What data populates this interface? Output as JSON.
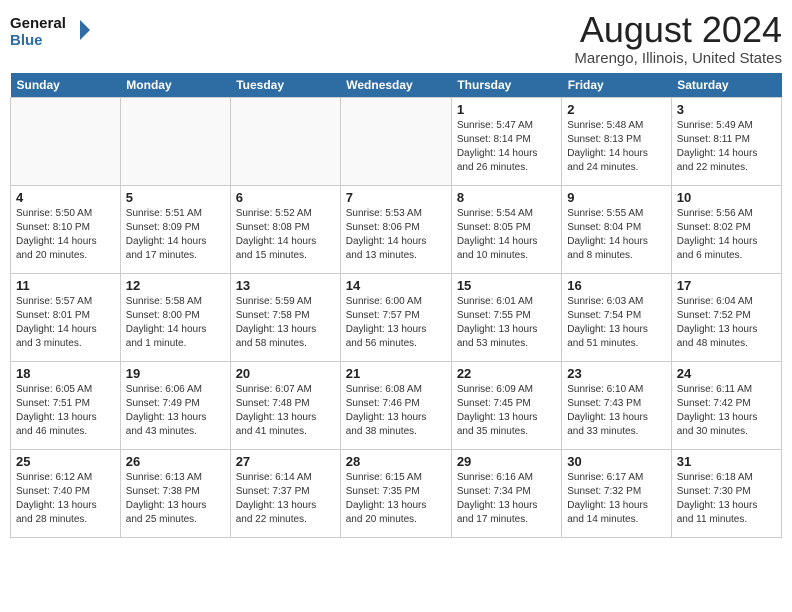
{
  "logo": {
    "line1": "General",
    "line2": "Blue"
  },
  "title": "August 2024",
  "location": "Marengo, Illinois, United States",
  "weekdays": [
    "Sunday",
    "Monday",
    "Tuesday",
    "Wednesday",
    "Thursday",
    "Friday",
    "Saturday"
  ],
  "weeks": [
    [
      {
        "day": "",
        "info": ""
      },
      {
        "day": "",
        "info": ""
      },
      {
        "day": "",
        "info": ""
      },
      {
        "day": "",
        "info": ""
      },
      {
        "day": "1",
        "info": "Sunrise: 5:47 AM\nSunset: 8:14 PM\nDaylight: 14 hours\nand 26 minutes."
      },
      {
        "day": "2",
        "info": "Sunrise: 5:48 AM\nSunset: 8:13 PM\nDaylight: 14 hours\nand 24 minutes."
      },
      {
        "day": "3",
        "info": "Sunrise: 5:49 AM\nSunset: 8:11 PM\nDaylight: 14 hours\nand 22 minutes."
      }
    ],
    [
      {
        "day": "4",
        "info": "Sunrise: 5:50 AM\nSunset: 8:10 PM\nDaylight: 14 hours\nand 20 minutes."
      },
      {
        "day": "5",
        "info": "Sunrise: 5:51 AM\nSunset: 8:09 PM\nDaylight: 14 hours\nand 17 minutes."
      },
      {
        "day": "6",
        "info": "Sunrise: 5:52 AM\nSunset: 8:08 PM\nDaylight: 14 hours\nand 15 minutes."
      },
      {
        "day": "7",
        "info": "Sunrise: 5:53 AM\nSunset: 8:06 PM\nDaylight: 14 hours\nand 13 minutes."
      },
      {
        "day": "8",
        "info": "Sunrise: 5:54 AM\nSunset: 8:05 PM\nDaylight: 14 hours\nand 10 minutes."
      },
      {
        "day": "9",
        "info": "Sunrise: 5:55 AM\nSunset: 8:04 PM\nDaylight: 14 hours\nand 8 minutes."
      },
      {
        "day": "10",
        "info": "Sunrise: 5:56 AM\nSunset: 8:02 PM\nDaylight: 14 hours\nand 6 minutes."
      }
    ],
    [
      {
        "day": "11",
        "info": "Sunrise: 5:57 AM\nSunset: 8:01 PM\nDaylight: 14 hours\nand 3 minutes."
      },
      {
        "day": "12",
        "info": "Sunrise: 5:58 AM\nSunset: 8:00 PM\nDaylight: 14 hours\nand 1 minute."
      },
      {
        "day": "13",
        "info": "Sunrise: 5:59 AM\nSunset: 7:58 PM\nDaylight: 13 hours\nand 58 minutes."
      },
      {
        "day": "14",
        "info": "Sunrise: 6:00 AM\nSunset: 7:57 PM\nDaylight: 13 hours\nand 56 minutes."
      },
      {
        "day": "15",
        "info": "Sunrise: 6:01 AM\nSunset: 7:55 PM\nDaylight: 13 hours\nand 53 minutes."
      },
      {
        "day": "16",
        "info": "Sunrise: 6:03 AM\nSunset: 7:54 PM\nDaylight: 13 hours\nand 51 minutes."
      },
      {
        "day": "17",
        "info": "Sunrise: 6:04 AM\nSunset: 7:52 PM\nDaylight: 13 hours\nand 48 minutes."
      }
    ],
    [
      {
        "day": "18",
        "info": "Sunrise: 6:05 AM\nSunset: 7:51 PM\nDaylight: 13 hours\nand 46 minutes."
      },
      {
        "day": "19",
        "info": "Sunrise: 6:06 AM\nSunset: 7:49 PM\nDaylight: 13 hours\nand 43 minutes."
      },
      {
        "day": "20",
        "info": "Sunrise: 6:07 AM\nSunset: 7:48 PM\nDaylight: 13 hours\nand 41 minutes."
      },
      {
        "day": "21",
        "info": "Sunrise: 6:08 AM\nSunset: 7:46 PM\nDaylight: 13 hours\nand 38 minutes."
      },
      {
        "day": "22",
        "info": "Sunrise: 6:09 AM\nSunset: 7:45 PM\nDaylight: 13 hours\nand 35 minutes."
      },
      {
        "day": "23",
        "info": "Sunrise: 6:10 AM\nSunset: 7:43 PM\nDaylight: 13 hours\nand 33 minutes."
      },
      {
        "day": "24",
        "info": "Sunrise: 6:11 AM\nSunset: 7:42 PM\nDaylight: 13 hours\nand 30 minutes."
      }
    ],
    [
      {
        "day": "25",
        "info": "Sunrise: 6:12 AM\nSunset: 7:40 PM\nDaylight: 13 hours\nand 28 minutes."
      },
      {
        "day": "26",
        "info": "Sunrise: 6:13 AM\nSunset: 7:38 PM\nDaylight: 13 hours\nand 25 minutes."
      },
      {
        "day": "27",
        "info": "Sunrise: 6:14 AM\nSunset: 7:37 PM\nDaylight: 13 hours\nand 22 minutes."
      },
      {
        "day": "28",
        "info": "Sunrise: 6:15 AM\nSunset: 7:35 PM\nDaylight: 13 hours\nand 20 minutes."
      },
      {
        "day": "29",
        "info": "Sunrise: 6:16 AM\nSunset: 7:34 PM\nDaylight: 13 hours\nand 17 minutes."
      },
      {
        "day": "30",
        "info": "Sunrise: 6:17 AM\nSunset: 7:32 PM\nDaylight: 13 hours\nand 14 minutes."
      },
      {
        "day": "31",
        "info": "Sunrise: 6:18 AM\nSunset: 7:30 PM\nDaylight: 13 hours\nand 11 minutes."
      }
    ]
  ]
}
